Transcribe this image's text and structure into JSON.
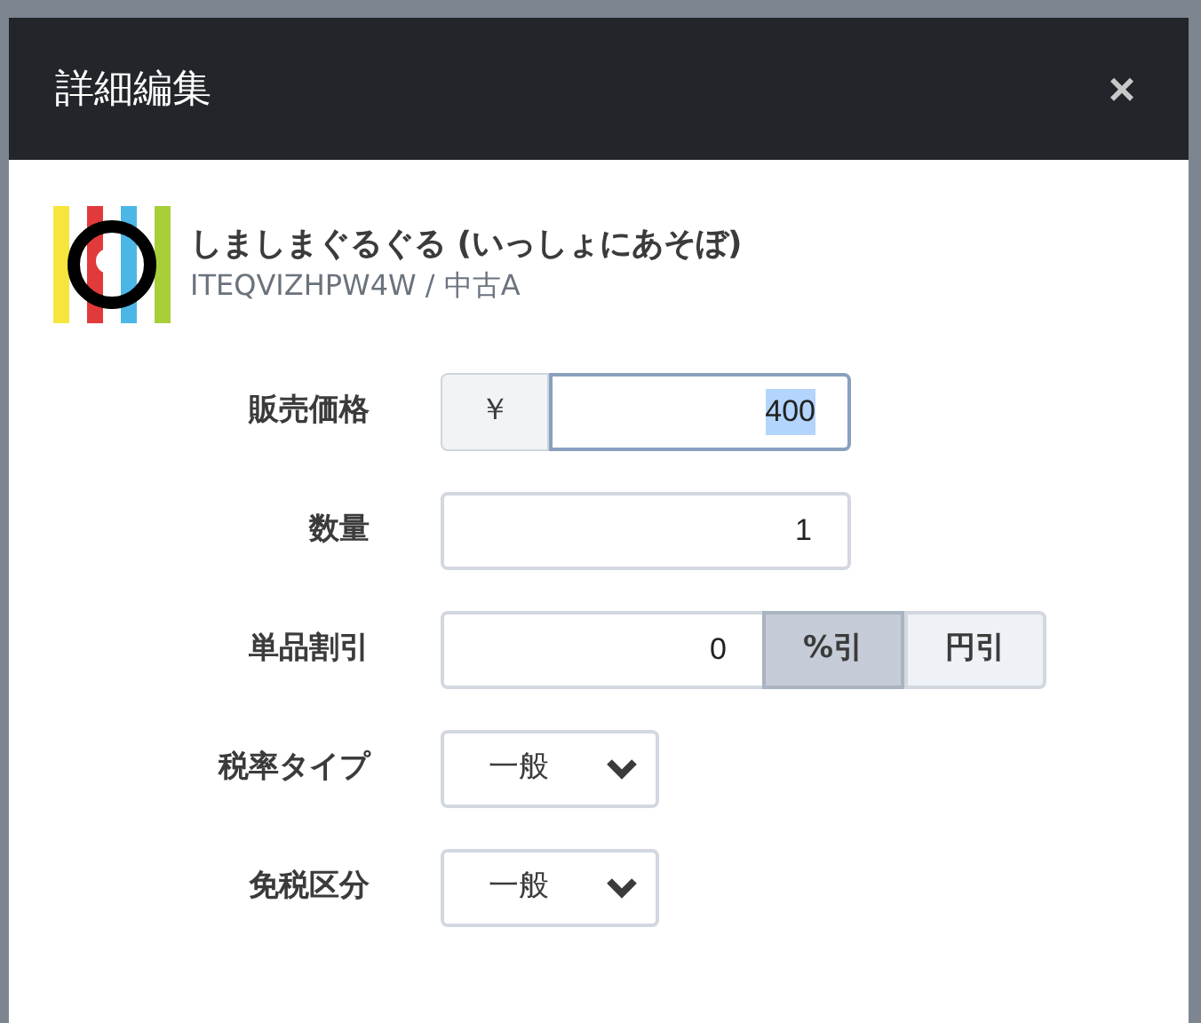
{
  "dialog": {
    "title": "詳細編集",
    "close": "×"
  },
  "product": {
    "name": "しましまぐるぐる (いっしょにあそぼ)",
    "subtitle": "ITEQVIZHPW4W / 中古A"
  },
  "fields": [
    {
      "kind": "price",
      "label": "販売価格",
      "prefix": "￥",
      "value": "400",
      "focused": true
    },
    {
      "kind": "number",
      "label": "数量",
      "value": "1",
      "focused": false
    },
    {
      "kind": "discount",
      "label": "単品割引",
      "value": "0",
      "options": [
        {
          "label": "%引",
          "selected": true
        },
        {
          "label": "円引",
          "selected": false
        }
      ]
    },
    {
      "kind": "select",
      "label": "税率タイプ",
      "value": "一般"
    },
    {
      "kind": "select",
      "label": "免税区分",
      "value": "一般"
    }
  ]
}
